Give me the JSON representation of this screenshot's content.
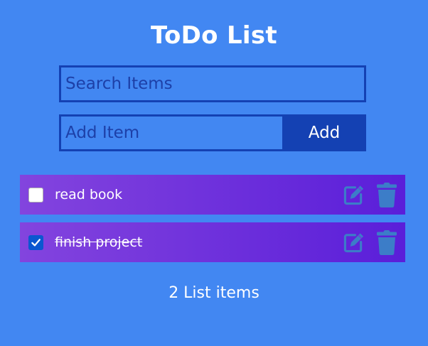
{
  "header": {
    "title": "ToDo List"
  },
  "search": {
    "placeholder": "Search Items",
    "value": ""
  },
  "add_form": {
    "placeholder": "Add Item",
    "value": "",
    "button_label": "Add"
  },
  "items": [
    {
      "label": "read book",
      "checked": false,
      "icons": [
        "edit-icon",
        "trash-icon"
      ]
    },
    {
      "label": "finish project",
      "checked": true,
      "icons": [
        "edit-icon",
        "trash-icon"
      ]
    }
  ],
  "footer": {
    "count_text": "2 List items"
  },
  "colors": {
    "background": "#4287f2",
    "accent": "#1441b3",
    "item_gradient_start": "#8344de",
    "item_gradient_end": "#5a1ed9",
    "icon": "#3c7dc8",
    "checkbox_checked": "#0b57d0"
  }
}
